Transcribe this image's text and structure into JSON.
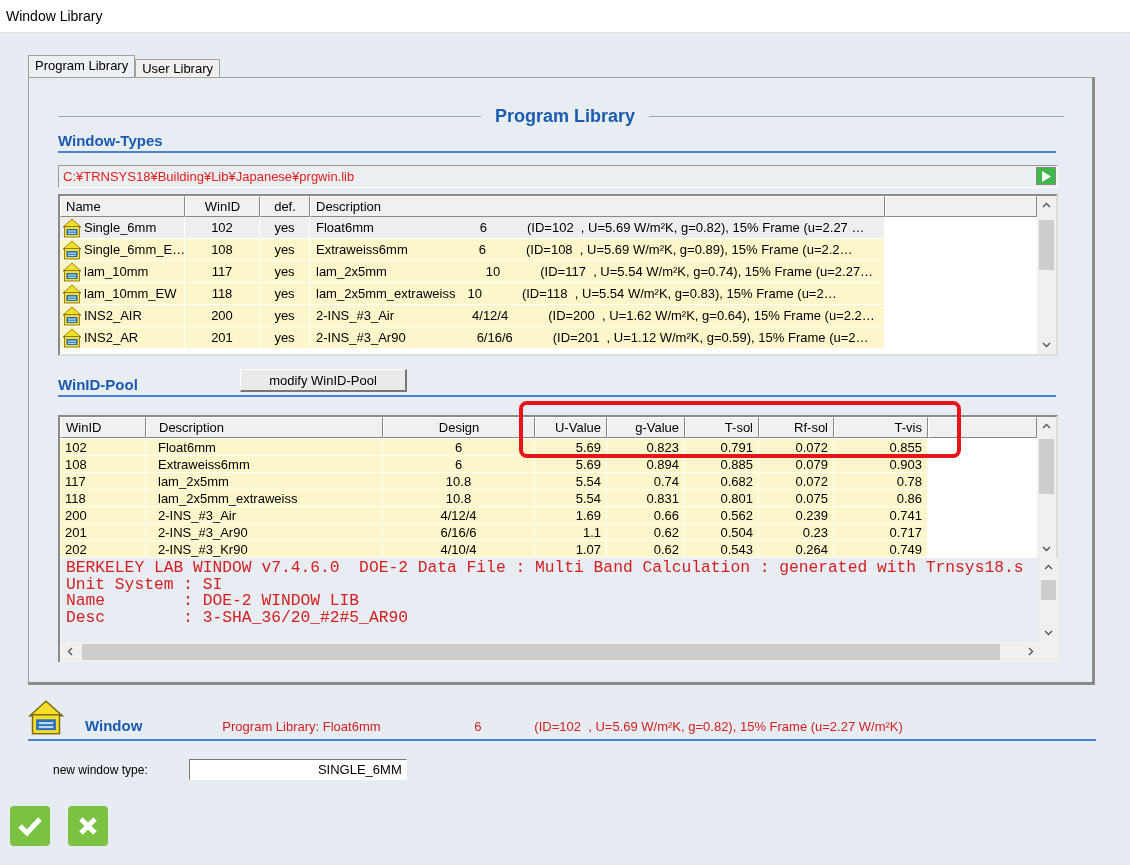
{
  "window": {
    "title": "Window Library"
  },
  "tabs": [
    {
      "label": "Program Library",
      "selected": true
    },
    {
      "label": "User Library",
      "selected": false
    }
  ],
  "panel_title": "Program Library",
  "window_types": {
    "heading": "Window-Types",
    "path": "C:¥TRNSYS18¥Building¥Lib¥Japanese¥prgwin.lib",
    "columns": [
      "Name",
      "WinID",
      "def.",
      "Description"
    ],
    "rows": [
      {
        "name": "Single_6mm",
        "winid": "102",
        "def": "yes",
        "desc": "Float6mm",
        "design": "6",
        "info": "(ID=102  , U=5.69 W/m²K, g=0.82), 15% Frame (u=2.27 …",
        "selected": true
      },
      {
        "name": "Single_6mm_E…",
        "winid": "108",
        "def": "yes",
        "desc": "Extraweiss6mm",
        "design": "6",
        "info": "(ID=108  , U=5.69 W/m²K, g=0.89), 15% Frame (u=2.2…",
        "selected": false
      },
      {
        "name": "lam_10mm",
        "winid": "117",
        "def": "yes",
        "desc": "lam_2x5mm",
        "design": "10",
        "info": "(ID=117  , U=5.54 W/m²K, g=0.74), 15% Frame (u=2.27…",
        "selected": false
      },
      {
        "name": "lam_10mm_EW",
        "winid": "118",
        "def": "yes",
        "desc": "lam_2x5mm_extraweiss",
        "design": "10",
        "info": "(ID=118  , U=5.54 W/m²K, g=0.83), 15% Frame (u=2…",
        "selected": false
      },
      {
        "name": "INS2_AIR",
        "winid": "200",
        "def": "yes",
        "desc": "2-INS_#3_Air",
        "design": "4/12/4",
        "info": "(ID=200  , U=1.62 W/m²K, g=0.64), 15% Frame (u=2.2…",
        "selected": false
      },
      {
        "name": "INS2_AR",
        "winid": "201",
        "def": "yes",
        "desc": "2-INS_#3_Ar90",
        "design": "6/16/6",
        "info": "(ID=201  , U=1.12 W/m²K, g=0.59), 15% Frame (u=2…",
        "selected": false
      }
    ]
  },
  "winid_pool": {
    "heading": "WinID-Pool",
    "button": "modify WinID-Pool",
    "columns": [
      "WinID",
      "Description",
      "Design",
      "U-Value",
      "g-Value",
      "T-sol",
      "Rf-sol",
      "T-vis"
    ],
    "rows": [
      [
        "102",
        "Float6mm",
        "6",
        "5.69",
        "0.823",
        "0.791",
        "0.072",
        "0.855"
      ],
      [
        "108",
        "Extraweiss6mm",
        "6",
        "5.69",
        "0.894",
        "0.885",
        "0.079",
        "0.903"
      ],
      [
        "117",
        "lam_2x5mm",
        "10.8",
        "5.54",
        "0.74",
        "0.682",
        "0.072",
        "0.78"
      ],
      [
        "118",
        "lam_2x5mm_extraweiss",
        "10.8",
        "5.54",
        "0.831",
        "0.801",
        "0.075",
        "0.86"
      ],
      [
        "200",
        "2-INS_#3_Air",
        "4/12/4",
        "1.69",
        "0.66",
        "0.562",
        "0.239",
        "0.741"
      ],
      [
        "201",
        "2-INS_#3_Ar90",
        "6/16/6",
        "1.1",
        "0.62",
        "0.504",
        "0.23",
        "0.717"
      ],
      [
        "202",
        "2-INS_#3_Kr90",
        "4/10/4",
        "1.07",
        "0.62",
        "0.543",
        "0.264",
        "0.749"
      ]
    ]
  },
  "details": [
    "BERKELEY LAB WINDOW v7.4.6.0  DOE-2 Data File : Multi Band Calculation : generated with Trnsys18.s",
    "Unit System : SI",
    "Name        : DOE-2 WINDOW LIB",
    "Desc        : 3-SHA_36/20_#2#5_AR90"
  ],
  "selection": {
    "heading": "Window",
    "source": "Program Library: Float6mm",
    "design": "6",
    "info": "(ID=102  , U=5.69 W/m²K, g=0.82), 15% Frame (u=2.27 W/m²K)"
  },
  "new_window_type": {
    "label": "new window type:",
    "value": "SINGLE_6MM"
  },
  "buttons": [
    {
      "kind": "ok"
    },
    {
      "kind": "cancel"
    }
  ]
}
